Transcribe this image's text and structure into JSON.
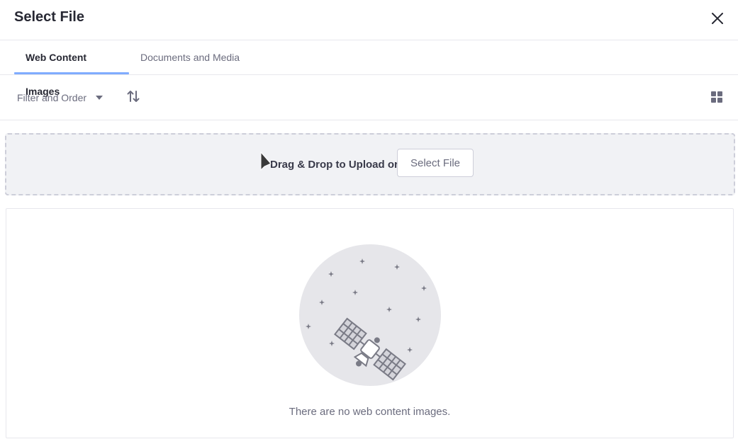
{
  "header": {
    "title": "Select File",
    "close_icon": "times-icon"
  },
  "tabs": [
    {
      "label": "Web Content Images",
      "active": true
    },
    {
      "label": "Documents and Media",
      "active": false
    }
  ],
  "toolbar": {
    "filter_label": "Filter and Order",
    "filter_icon": "caret-down-icon",
    "order_icon": "order-arrow-icon",
    "view_icon": "cards-view-icon"
  },
  "dropzone": {
    "text": "Drag & Drop to Upload or",
    "button_label": "Select File"
  },
  "empty_state": {
    "illustration": "satellite-illustration",
    "message": "There are no web content images."
  },
  "colors": {
    "accent": "#80acff",
    "text_primary": "#272833",
    "text_secondary": "#6b6c7e",
    "border": "#e7e7ed",
    "dropzone_bg": "#f1f2f5"
  }
}
